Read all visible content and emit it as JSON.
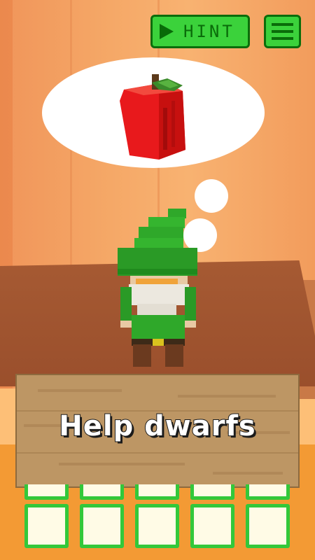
{
  "header": {
    "hint_label": "HINT",
    "hint_icon": "play-triangle-icon",
    "menu_icon": "hamburger-menu-icon"
  },
  "thought": {
    "item": "apple",
    "item_color": "#e8191c"
  },
  "character": {
    "type": "dwarf",
    "hat_color": "#2fa82a",
    "beard_color": "#ece8df"
  },
  "sign": {
    "text": "Help dwarfs"
  },
  "inventory": {
    "top_row_count": 5,
    "bottom_row_count": 5,
    "slot_border_color": "#33c83a"
  },
  "colors": {
    "button_green": "#3bd23b",
    "button_dark_green": "#0b6d0b",
    "wall": "#f5a867",
    "table": "#a65a33"
  }
}
